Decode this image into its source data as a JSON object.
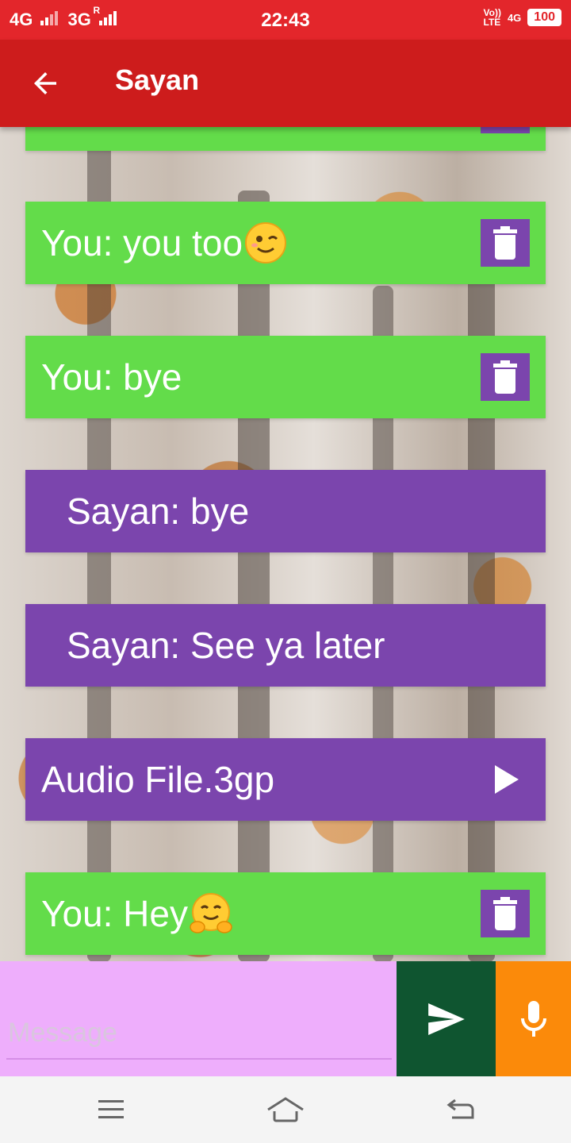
{
  "status_bar": {
    "left_network_1": "4G",
    "left_network_2": "3G",
    "roaming": "R",
    "time": "22:43",
    "volte": "Vo))",
    "lte": "LTE",
    "right_network": "4G",
    "battery": "100"
  },
  "app_bar": {
    "title": "Sayan"
  },
  "messages": [
    {
      "text": "You: you too",
      "emoji": "winking-face"
    },
    {
      "text": "You: bye"
    },
    {
      "text": "Sayan: bye"
    },
    {
      "text": "Sayan: See ya later"
    },
    {
      "text": "Audio File.3gp"
    },
    {
      "text": "You: Hey",
      "emoji": "hugging-face"
    }
  ],
  "composer": {
    "placeholder": "Message"
  },
  "colors": {
    "status_bar": "#e3262b",
    "app_bar": "#cd1c1c",
    "sent_bubble": "#63dc4a",
    "received_bubble": "#7b45ad",
    "composer_bg": "#eeaefc",
    "send_button": "#0f5530",
    "mic_button": "#fb8a0a"
  }
}
